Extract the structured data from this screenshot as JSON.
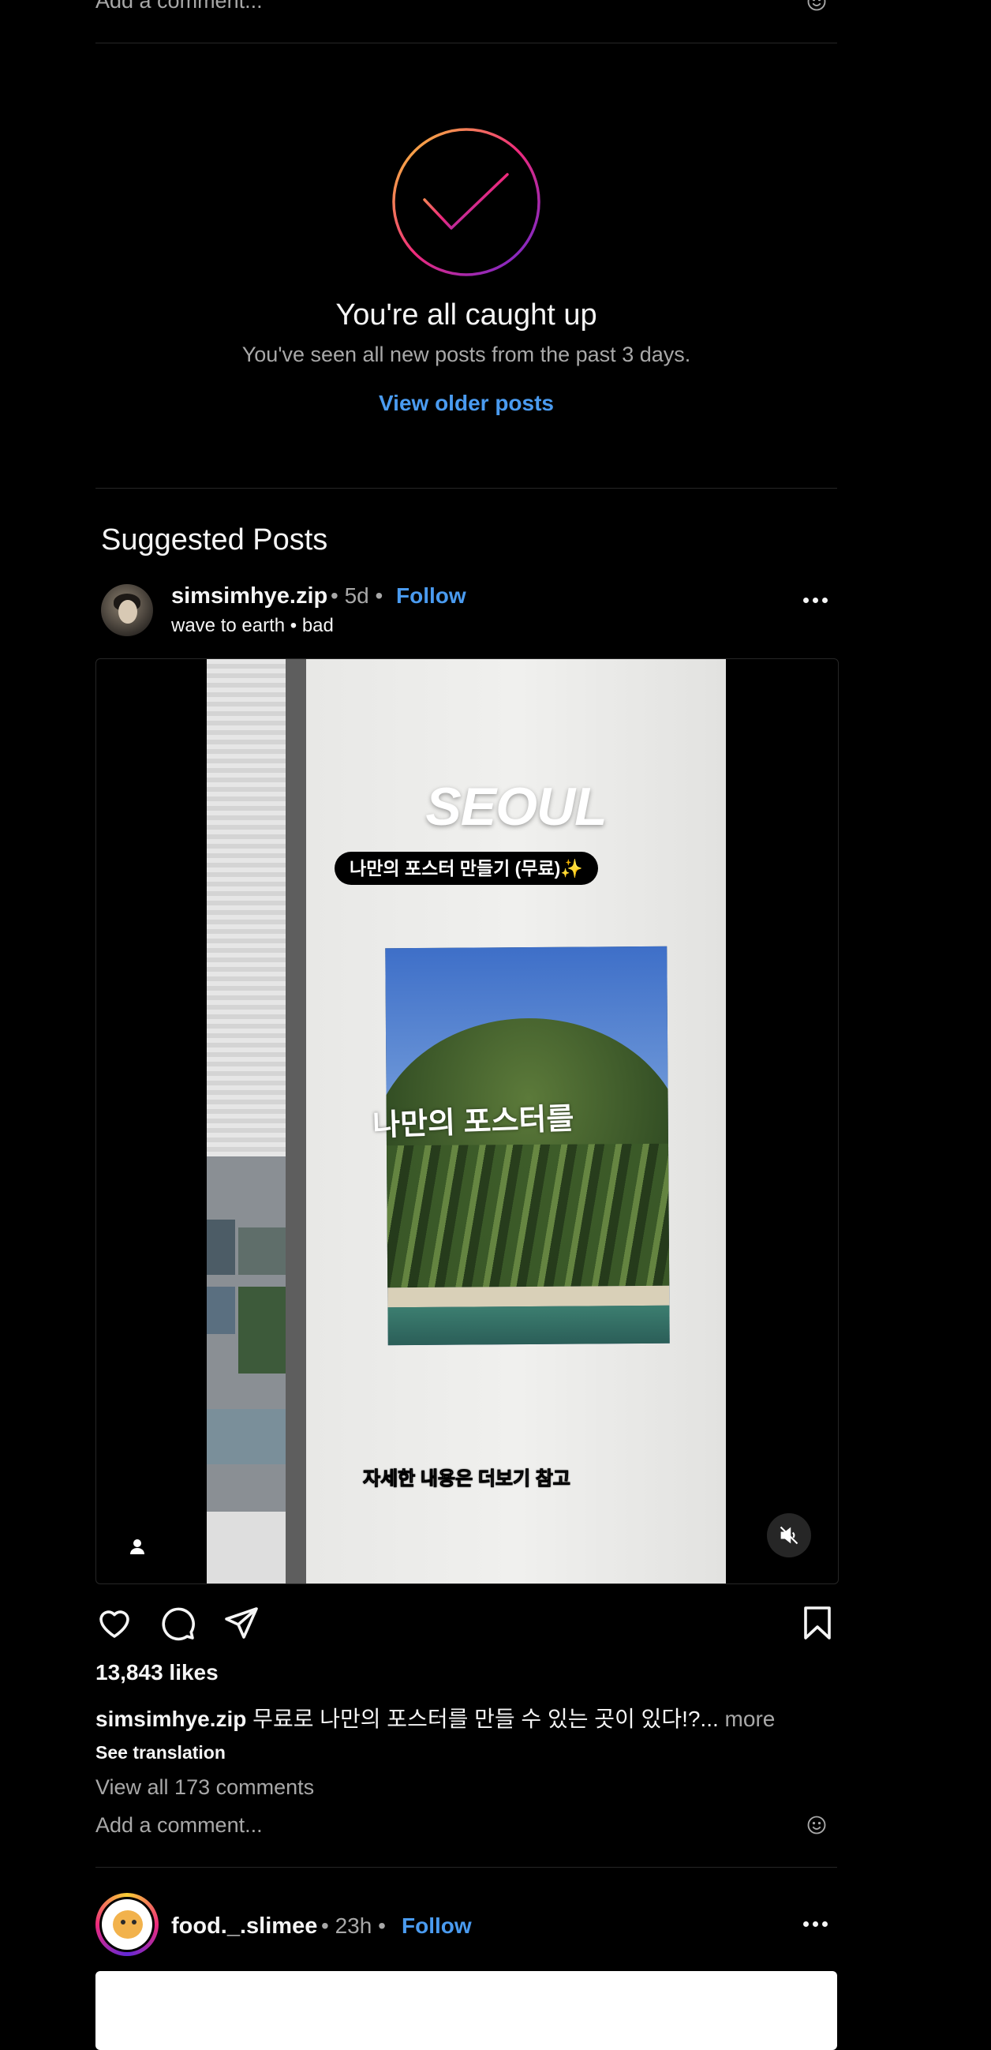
{
  "previous_post": {
    "add_comment_placeholder": "Add a comment...",
    "emoji_icon": "smiley-face-icon"
  },
  "caught_up": {
    "title": "You're all caught up",
    "subtitle": "You've seen all new posts from the past 3 days.",
    "older_link": "View older posts",
    "ring_colors": [
      "#f9ce34",
      "#ee2a7b",
      "#6228d7"
    ]
  },
  "suggested": {
    "heading": "Suggested Posts"
  },
  "post1": {
    "username": "simsimhye.zip",
    "age": "• 5d •",
    "follow_label": "Follow",
    "audio": "wave to earth • bad",
    "media": {
      "overlay_title": "SEOUL",
      "overlay_pill": "나만의 포스터 만들기 (무료)✨",
      "overlay_mid": "나만의 포스터를",
      "overlay_caption": "자세한 내용은 더보기 참고"
    },
    "likes": "13,843 likes",
    "caption_user": "simsimhye.zip",
    "caption_text": " 무료로 나만의 포스터를 만들 수 있는 곳이 있다!?...",
    "caption_more": " more",
    "see_translation": "See translation",
    "view_comments": "View all 173 comments",
    "add_comment_placeholder": "Add a comment..."
  },
  "post2": {
    "username": "food._.slimee",
    "age": "• 23h •",
    "follow_label": "Follow"
  },
  "colors": {
    "link_blue": "#4a9bf0",
    "muted_text": "#a8a8a8",
    "divider": "#262626"
  }
}
